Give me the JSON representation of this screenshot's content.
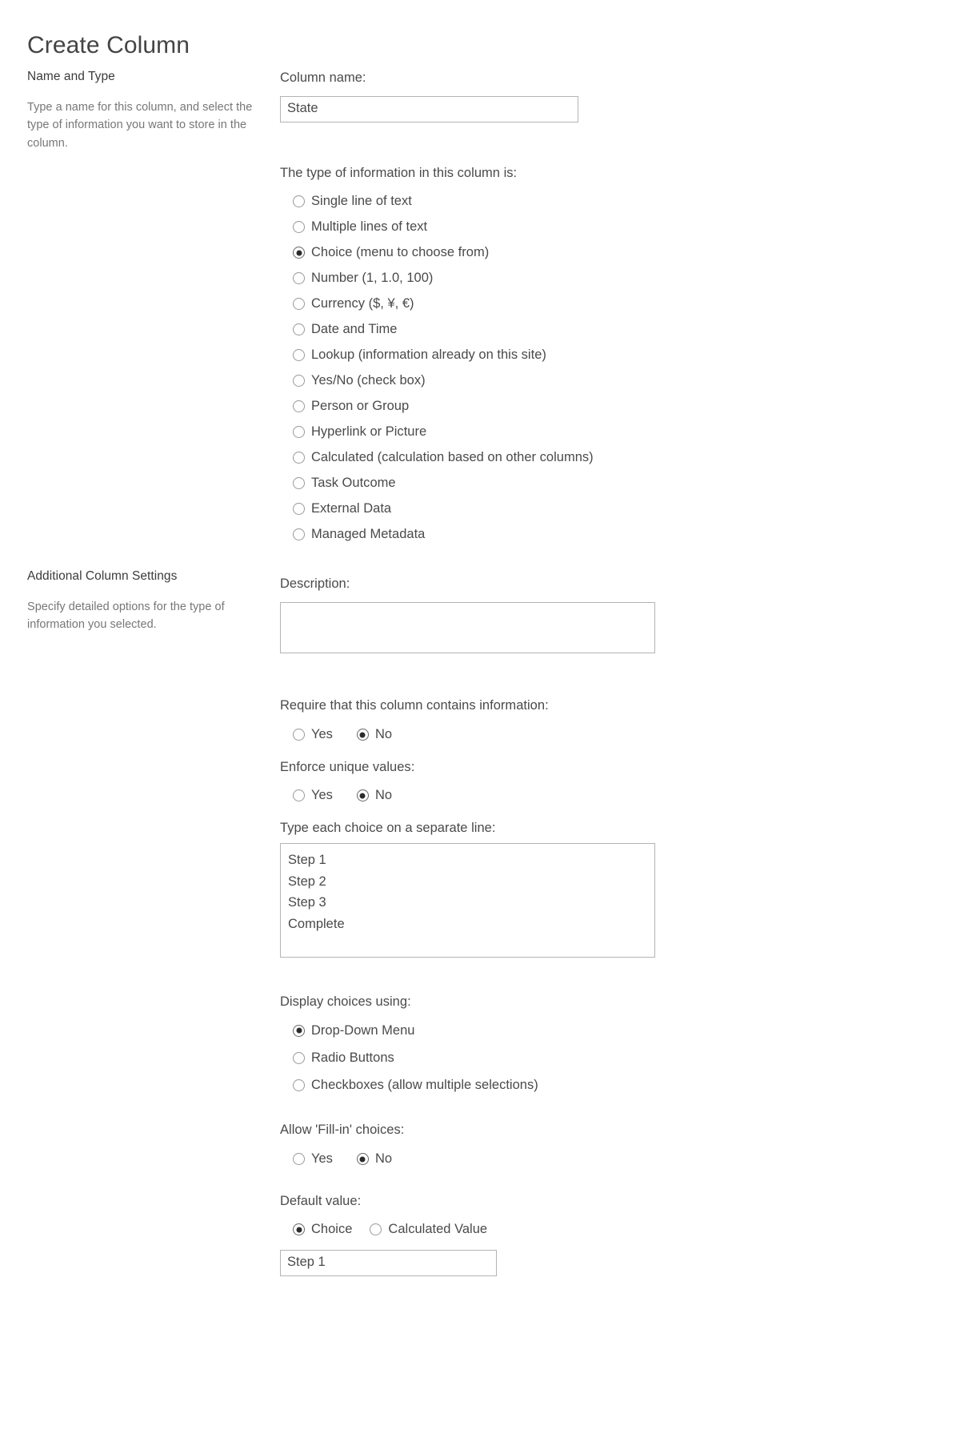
{
  "page": {
    "title": "Create Column"
  },
  "sections": [
    {
      "heading": "Name and Type",
      "description": "Type a name for this column, and select the type of information you want to store in the column."
    },
    {
      "heading": "Additional Column Settings",
      "description": "Specify detailed options for the type of information you selected."
    }
  ],
  "name_and_type": {
    "column_name_label": "Column name:",
    "column_name_value": "State",
    "column_name_placeholder": "",
    "type_label": "The type of information in this column is:",
    "types": [
      {
        "label": "Single line of text",
        "selected": false
      },
      {
        "label": "Multiple lines of text",
        "selected": false
      },
      {
        "label": "Choice (menu to choose from)",
        "selected": true
      },
      {
        "label": "Number (1, 1.0, 100)",
        "selected": false
      },
      {
        "label": "Currency ($, ¥, €)",
        "selected": false
      },
      {
        "label": "Date and Time",
        "selected": false
      },
      {
        "label": "Lookup (information already on this site)",
        "selected": false
      },
      {
        "label": "Yes/No (check box)",
        "selected": false
      },
      {
        "label": "Person or Group",
        "selected": false
      },
      {
        "label": "Hyperlink or Picture",
        "selected": false
      },
      {
        "label": "Calculated (calculation based on other columns)",
        "selected": false
      },
      {
        "label": "Task Outcome",
        "selected": false
      },
      {
        "label": "External Data",
        "selected": false
      },
      {
        "label": "Managed Metadata",
        "selected": false
      }
    ]
  },
  "additional_settings": {
    "description_label": "Description:",
    "description_value": "",
    "description_placeholder": "",
    "require_label": "Require that this column contains information:",
    "require_options": [
      {
        "label": "Yes",
        "selected": false
      },
      {
        "label": "No",
        "selected": true
      }
    ],
    "enforce_label": "Enforce unique values:",
    "enforce_options": [
      {
        "label": "Yes",
        "selected": false
      },
      {
        "label": "No",
        "selected": true
      }
    ],
    "choices_label": "Type each choice on a separate line:",
    "choices_value": "Step 1\nStep 2\nStep 3\nComplete",
    "display_label": "Display choices using:",
    "display_options": [
      {
        "label": "Drop-Down Menu",
        "selected": true
      },
      {
        "label": "Radio Buttons",
        "selected": false
      },
      {
        "label": "Checkboxes (allow multiple selections)",
        "selected": false
      }
    ],
    "fillin_label": "Allow 'Fill-in' choices:",
    "fillin_options": [
      {
        "label": "Yes",
        "selected": false
      },
      {
        "label": "No",
        "selected": true
      }
    ],
    "default_label": "Default value:",
    "default_options": [
      {
        "label": "Choice",
        "selected": true
      },
      {
        "label": "Calculated Value",
        "selected": false
      }
    ],
    "default_value": "Step 1",
    "default_placeholder": ""
  }
}
